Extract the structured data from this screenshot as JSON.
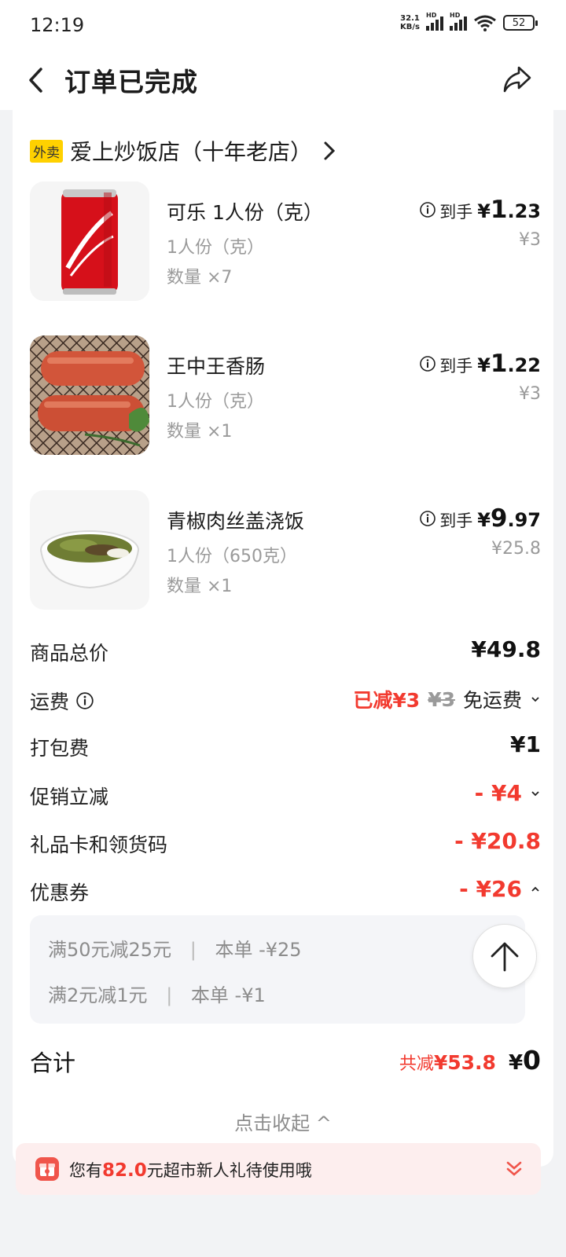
{
  "status_bar": {
    "time": "12:19",
    "net_speed_value": "32.1",
    "net_speed_unit": "KB/s",
    "hd": "HD",
    "battery": "52",
    "wifi_icon": "wifi-icon",
    "signal_icon": "signal-icon"
  },
  "header": {
    "title": "订单已完成",
    "back_icon": "chevron-left-icon",
    "share_icon": "share-icon"
  },
  "shop": {
    "tag": "外卖",
    "name": "爱上炒饭店（十年老店）"
  },
  "items": [
    {
      "name": "可乐 1人份（克）",
      "spec": "1人份（克）",
      "qty": "数量 ×7",
      "label": "到手",
      "yen": "¥",
      "price_int": "1",
      "price_dec": ".23",
      "original": "¥3"
    },
    {
      "name": "王中王香肠",
      "spec": "1人份（克）",
      "qty": "数量 ×1",
      "label": "到手",
      "yen": "¥",
      "price_int": "1",
      "price_dec": ".22",
      "original": "¥3"
    },
    {
      "name": "青椒肉丝盖浇饭",
      "spec": "1人份（650克）",
      "qty": "数量 ×1",
      "label": "到手",
      "yen": "¥",
      "price_int": "9",
      "price_dec": ".97",
      "original": "¥25.8"
    }
  ],
  "summary": {
    "goods_total": {
      "label": "商品总价",
      "value": "¥49.8"
    },
    "delivery": {
      "label": "运费",
      "reduced": "已减¥3",
      "original": "¥3",
      "free": "免运费"
    },
    "packing": {
      "label": "打包费",
      "value": "¥1"
    },
    "promo": {
      "label": "促销立减",
      "value": "- ¥4"
    },
    "giftcard": {
      "label": "礼品卡和领货码",
      "value": "- ¥20.8"
    },
    "coupon": {
      "label": "优惠券",
      "value": "- ¥26"
    }
  },
  "coupons": [
    {
      "rule": "满50元减25元",
      "sep": "|",
      "saving": "本单 -¥25"
    },
    {
      "rule": "满2元减1元",
      "sep": "|",
      "saving": "本单 -¥1"
    }
  ],
  "total": {
    "label": "合计",
    "reduce_prefix": "共减",
    "reduce_amount": "¥53.8",
    "yen": "¥",
    "amount": "0"
  },
  "collapse_label": "点击收起 ^",
  "banner": {
    "prefix": "您有",
    "amount": "82.0",
    "suffix": "元超市新人礼待使用哦",
    "gift_icon": "gift-icon",
    "expand_icon": "double-chevron-down-icon"
  },
  "colors": {
    "accent_red": "#f23a2f",
    "tag_yellow": "#ffd100",
    "banner_bg": "#fdeeee"
  }
}
